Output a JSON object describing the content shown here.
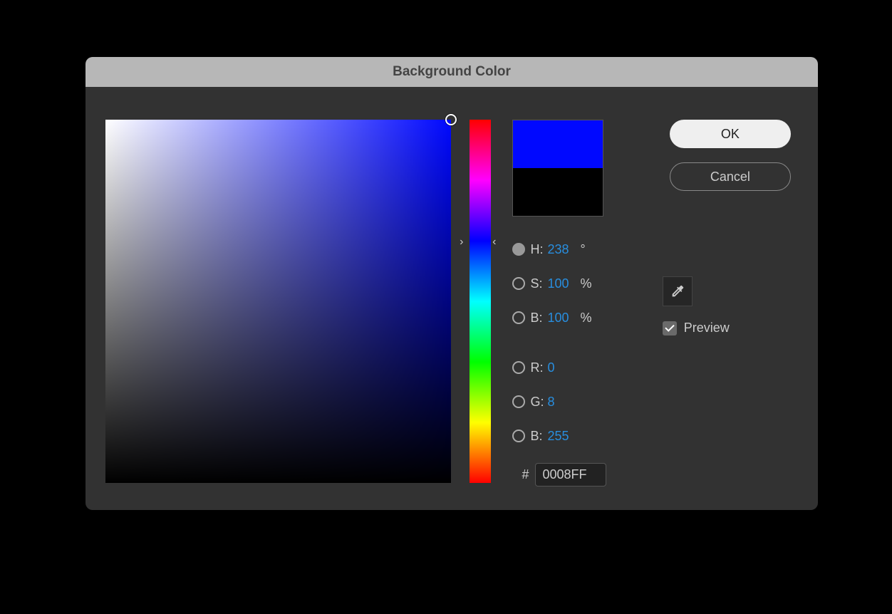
{
  "dialog": {
    "title": "Background Color",
    "ok_label": "OK",
    "cancel_label": "Cancel",
    "preview_label": "Preview",
    "preview_checked": true
  },
  "color": {
    "current_hex": "0008FF",
    "current_css": "#0008FF",
    "previous_css": "#000000",
    "hue_pct": 33.8,
    "sb_thumb": {
      "x_pct": 100,
      "y_pct": 0
    }
  },
  "fields": {
    "H": {
      "label": "H:",
      "value": "238",
      "unit": "°",
      "selected": true
    },
    "S": {
      "label": "S:",
      "value": "100",
      "unit": "%",
      "selected": false
    },
    "Bv": {
      "label": "B:",
      "value": "100",
      "unit": "%",
      "selected": false
    },
    "R": {
      "label": "R:",
      "value": "0",
      "unit": "",
      "selected": false
    },
    "G": {
      "label": "G:",
      "value": "8",
      "unit": "",
      "selected": false
    },
    "Bc": {
      "label": "B:",
      "value": "255",
      "unit": "",
      "selected": false
    }
  },
  "hex": {
    "symbol": "#"
  }
}
